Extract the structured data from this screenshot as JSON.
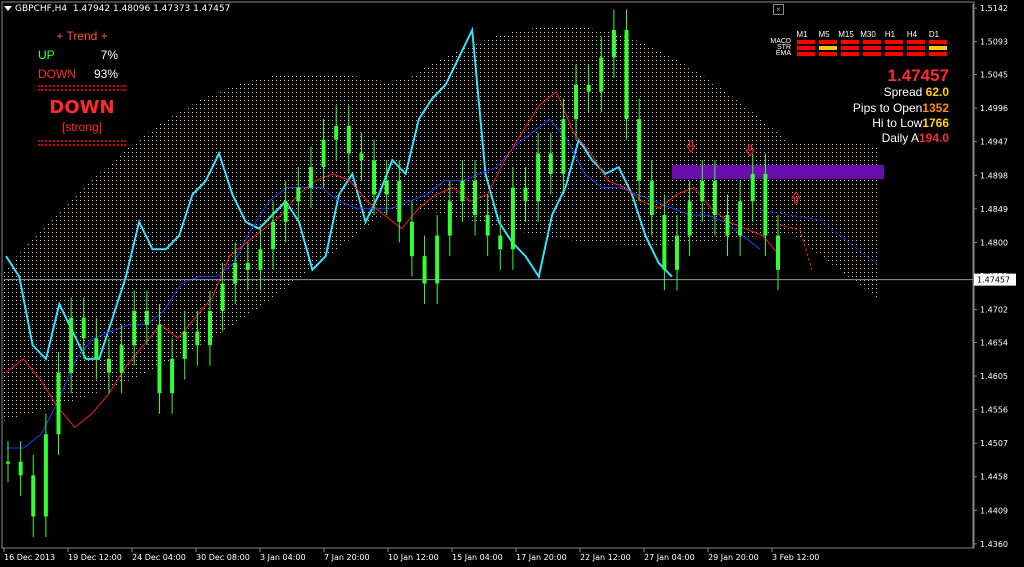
{
  "header": {
    "symbol": "GBPCHF,H4",
    "ohlc": "1.47942 1.48096 1.47373 1.47457"
  },
  "trend_panel": {
    "title": "+ Trend +",
    "up_label": "UP",
    "up_value": "7%",
    "down_label": "DOWN",
    "down_value": "93%",
    "signal": "DOWN",
    "strength": "[strong]"
  },
  "indicator_panel": {
    "timeframes": [
      "M1",
      "M5",
      "M15",
      "M30",
      "H1",
      "H4",
      "D1"
    ],
    "rows": [
      {
        "name": "MACD",
        "colors": [
          "#ff0000",
          "#ff0000",
          "#ff0000",
          "#ff0000",
          "#ff0000",
          "#ff0000",
          "#ff0000"
        ]
      },
      {
        "name": "STR",
        "colors": [
          "#ff0000",
          "#ffcc00",
          "#ff0000",
          "#ff0000",
          "#ff0000",
          "#ff0000",
          "#ffcc00"
        ]
      },
      {
        "name": "EMA",
        "colors": [
          "#ff0000",
          "#ff0000",
          "#ff0000",
          "#ff0000",
          "#ff0000",
          "#ff0000",
          "#ff0000"
        ]
      }
    ],
    "price": "1.47457",
    "spread_label": "Spread",
    "spread_value": "62.0",
    "pips_open_label": "Pips to Open",
    "pips_open_value": "1352",
    "hi_low_label": "Hi to Low",
    "hi_low_value": "1766",
    "daily_label": "Daily A",
    "daily_value": "194.0"
  },
  "colors": {
    "background": "#000000",
    "candles": "#33ff33",
    "cyan_line": "#33e0ff",
    "blue_line": "#1a3cff",
    "red_line": "#ff1a1a",
    "cloud": "#ffd2b4",
    "zone": "#6a0dad",
    "price_line": "#8a9bb0"
  },
  "chart_data": {
    "type": "line",
    "title": "",
    "xlabel": "",
    "ylabel": "",
    "ylim": [
      1.4354,
      1.5148
    ],
    "y_ticks": [
      1.5142,
      1.5093,
      1.5045,
      1.4996,
      1.4947,
      1.4898,
      1.4849,
      1.48,
      1.4751,
      1.4702,
      1.4654,
      1.4605,
      1.4556,
      1.4507,
      1.4458,
      1.4409,
      1.436
    ],
    "x_ticks": [
      "16 Dec 2013",
      "19 Dec 12:00",
      "24 Dec 04:00",
      "30 Dec 08:00",
      "3 Jan 04:00",
      "7 Jan 20:00",
      "10 Jan 12:00",
      "15 Jan 04:00",
      "17 Jan 20:00",
      "22 Jan 12:00",
      "27 Jan 04:00",
      "29 Jan 20:00",
      "3 Feb 12:00"
    ],
    "current_price": "1.47457",
    "current_price_value": 1.47457,
    "grid": false,
    "series": [
      {
        "role": "price",
        "values": [
          1.448,
          1.446,
          1.44,
          1.452,
          1.461,
          1.469,
          1.466,
          1.463,
          1.461,
          1.465,
          1.47,
          1.468,
          1.458,
          1.463,
          1.467,
          1.465,
          1.47,
          1.474,
          1.477,
          1.476,
          1.479,
          1.483,
          1.486,
          1.488,
          1.491,
          1.495,
          1.497,
          1.493,
          1.492,
          1.487,
          1.489,
          1.483,
          1.478,
          1.474,
          1.481,
          1.486,
          1.489,
          1.484,
          1.481,
          1.479,
          1.488,
          1.486,
          1.493,
          1.49,
          1.498,
          1.503,
          1.502,
          1.507,
          1.511,
          1.498,
          1.489,
          1.484,
          1.476,
          1.481,
          1.486,
          1.489,
          1.484,
          1.481,
          1.486,
          1.49,
          1.481,
          1.476
        ]
      },
      {
        "role": "cyan",
        "values": [
          1.478,
          1.475,
          1.465,
          1.463,
          1.471,
          1.467,
          1.463,
          1.463,
          1.469,
          1.475,
          1.483,
          1.479,
          1.479,
          1.481,
          1.487,
          1.489,
          1.493,
          1.487,
          1.483,
          1.482,
          1.484,
          1.486,
          1.483,
          1.476,
          1.478,
          1.487,
          1.49,
          1.483,
          1.487,
          1.492,
          1.49,
          1.498,
          1.501,
          1.503,
          1.507,
          1.511,
          1.49,
          1.483,
          1.48,
          1.478,
          1.475,
          1.484,
          1.488,
          1.495,
          1.492,
          1.49,
          1.491,
          1.487,
          1.481,
          1.477,
          1.475
        ]
      },
      {
        "role": "red",
        "values": [
          1.461,
          1.463,
          1.46,
          1.456,
          1.453,
          1.455,
          1.458,
          1.462,
          1.465,
          1.468,
          1.466,
          1.469,
          1.472,
          1.478,
          1.48,
          1.482,
          1.484,
          1.487,
          1.489,
          1.49,
          1.489,
          1.486,
          1.484,
          1.482,
          1.485,
          1.487,
          1.488,
          1.486,
          1.487,
          1.492,
          1.496,
          1.5,
          1.502,
          1.496,
          1.493,
          1.489,
          1.488,
          1.486,
          1.485,
          1.487,
          1.488,
          1.485,
          1.483,
          1.482,
          1.481,
          1.478
        ]
      },
      {
        "role": "blue",
        "values": [
          1.45,
          1.45,
          1.452,
          1.457,
          1.463,
          1.466,
          1.467,
          1.468,
          1.468,
          1.47,
          1.474,
          1.475,
          1.475,
          1.477,
          1.482,
          1.486,
          1.488,
          1.488,
          1.488,
          1.486,
          1.485,
          1.485,
          1.485,
          1.486,
          1.487,
          1.489,
          1.489,
          1.49,
          1.491,
          1.494,
          1.496,
          1.498,
          1.495,
          1.49,
          1.488,
          1.488,
          1.487,
          1.486,
          1.485,
          1.484,
          1.484,
          1.483,
          1.481,
          1.479
        ]
      }
    ]
  }
}
